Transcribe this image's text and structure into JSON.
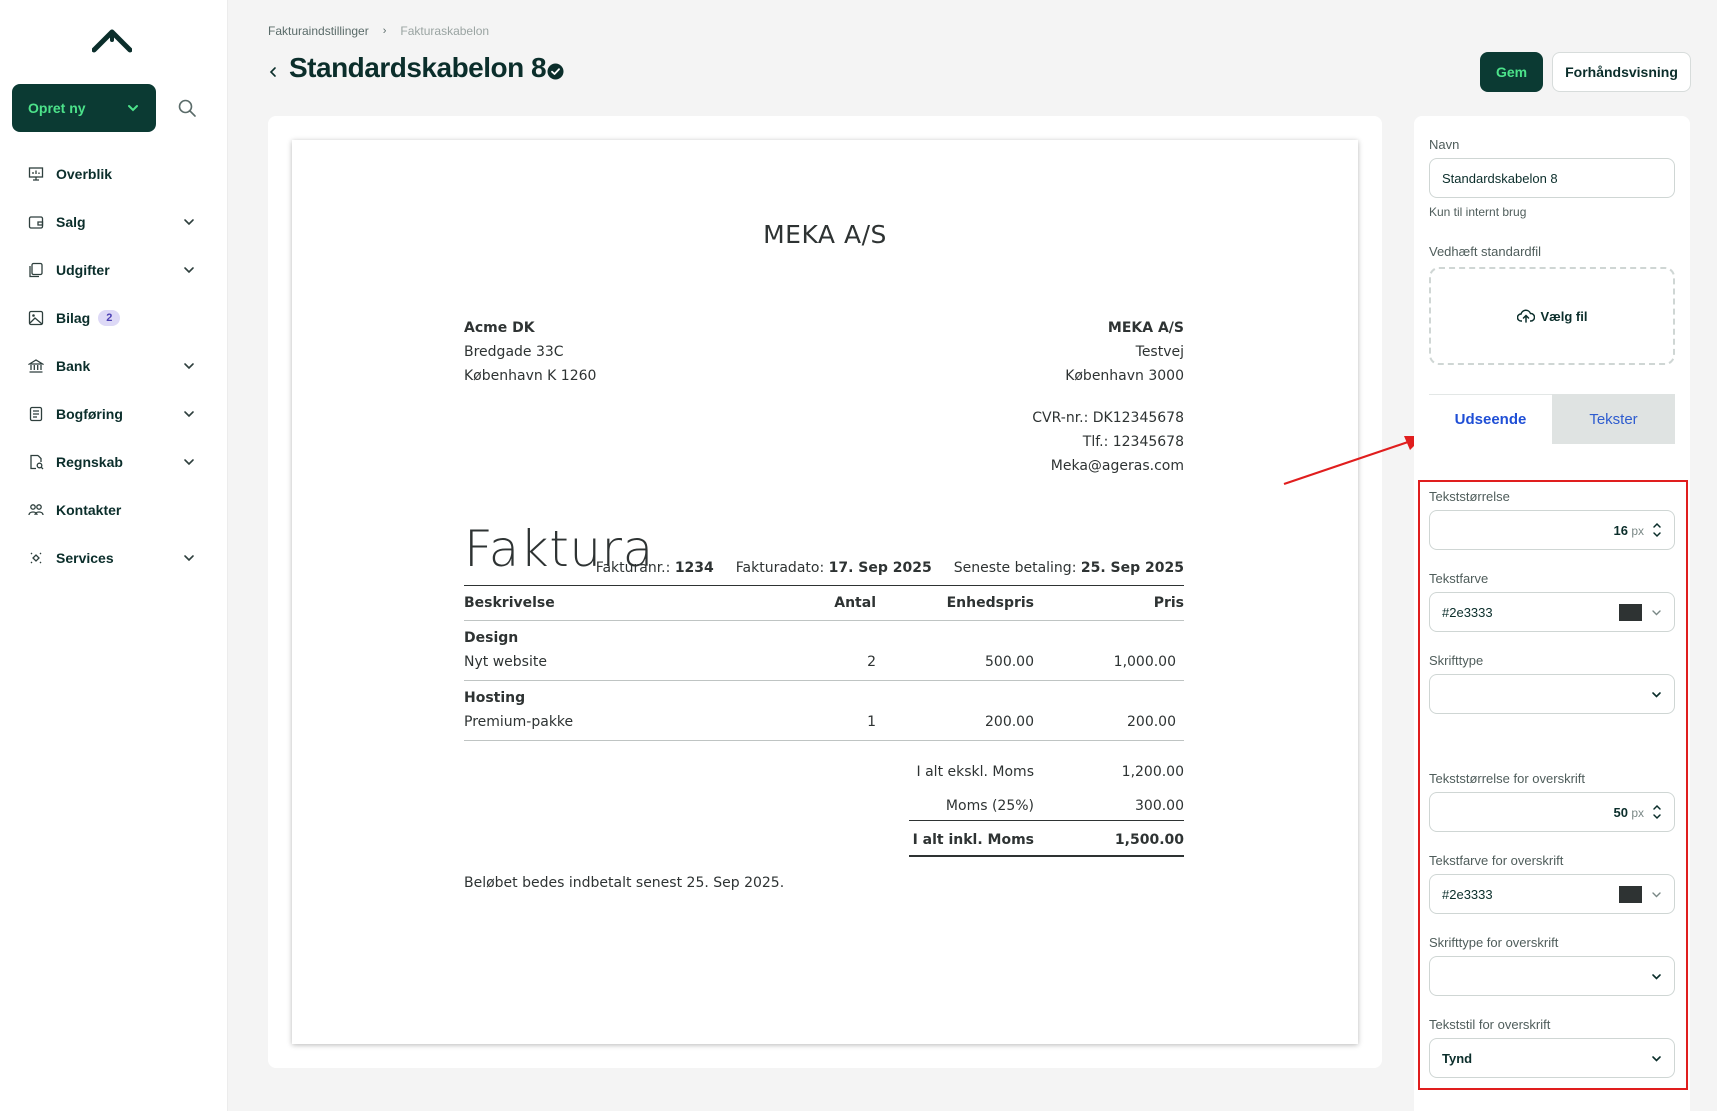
{
  "sidebar": {
    "create_label": "Opret ny",
    "items": [
      {
        "label": "Overblik",
        "icon": "presentation-icon",
        "has_chevron": false
      },
      {
        "label": "Salg",
        "icon": "wallet-icon",
        "has_chevron": true
      },
      {
        "label": "Udgifter",
        "icon": "receipt-stack-icon",
        "has_chevron": true
      },
      {
        "label": "Bilag",
        "icon": "image-file-icon",
        "has_chevron": false,
        "badge": "2"
      },
      {
        "label": "Bank",
        "icon": "bank-icon",
        "has_chevron": true
      },
      {
        "label": "Bogføring",
        "icon": "ledger-icon",
        "has_chevron": true
      },
      {
        "label": "Regnskab",
        "icon": "report-icon",
        "has_chevron": true
      },
      {
        "label": "Kontakter",
        "icon": "people-icon",
        "has_chevron": false
      },
      {
        "label": "Services",
        "icon": "services-icon",
        "has_chevron": true
      }
    ]
  },
  "header": {
    "breadcrumb": [
      "Fakturaindstillinger",
      "Fakturaskabelon"
    ],
    "breadcrumb_separator": "›",
    "title": "Standardskabelon 8",
    "save_label": "Gem",
    "preview_label": "Forhåndsvisning"
  },
  "invoice": {
    "company_heading": "MEKA A/S",
    "recipient": {
      "name": "Acme DK",
      "street": "Bredgade 33C",
      "city": "København K 1260"
    },
    "sender": {
      "name": "MEKA A/S",
      "street": "Testvej",
      "city": "København 3000",
      "cvr": "CVR-nr.: DK12345678",
      "phone": "Tlf.: 12345678",
      "email": "Meka@ageras.com"
    },
    "doc_title": "Faktura",
    "meta": {
      "number_label": "Fakturanr.:",
      "number": "1234",
      "date_label": "Fakturadato:",
      "date": "17. Sep 2025",
      "due_label": "Seneste betaling:",
      "due": "25. Sep 2025"
    },
    "columns": {
      "description": "Beskrivelse",
      "qty": "Antal",
      "unit_price": "Enhedspris",
      "price": "Pris"
    },
    "groups": [
      {
        "name": "Design",
        "item": "Nyt website",
        "qty": "2",
        "unit_price": "500.00",
        "price": "1,000.00"
      },
      {
        "name": "Hosting",
        "item": "Premium-pakke",
        "qty": "1",
        "unit_price": "200.00",
        "price": "200.00"
      }
    ],
    "totals": {
      "subtotal_label": "I alt ekskl. Moms",
      "subtotal": "1,200.00",
      "vat_label": "Moms (25%)",
      "vat": "300.00",
      "total_label": "I alt inkl. Moms",
      "total": "1,500.00"
    },
    "note": "Beløbet bedes indbetalt senest 25. Sep 2025."
  },
  "settings": {
    "name_label": "Navn",
    "name_value": "Standardskabelon 8",
    "name_help": "Kun til internt brug",
    "attach_label": "Vedhæft standardfil",
    "attach_button": "Vælg fil",
    "tabs": {
      "appearance": "Udseende",
      "texts": "Tekster"
    },
    "text_size_label": "Tekststørrelse",
    "text_size": "16",
    "unit": "px",
    "text_color_label": "Tekstfarve",
    "text_color": "#2e3333",
    "font_label": "Skrifttype",
    "font_value": "",
    "heading_size_label": "Tekststørrelse for overskrift",
    "heading_size": "50",
    "heading_color_label": "Tekstfarve for overskrift",
    "heading_color": "#2e3333",
    "heading_font_label": "Skrifttype for overskrift",
    "heading_font_value": "",
    "heading_style_label": "Tekststil for overskrift",
    "heading_style_value": "Tynd"
  },
  "colors": {
    "brand_dark": "#0b3a33",
    "brand_green": "#4ce28a",
    "annotation_red": "#e01e1e",
    "link_blue": "#1f4fd6"
  }
}
